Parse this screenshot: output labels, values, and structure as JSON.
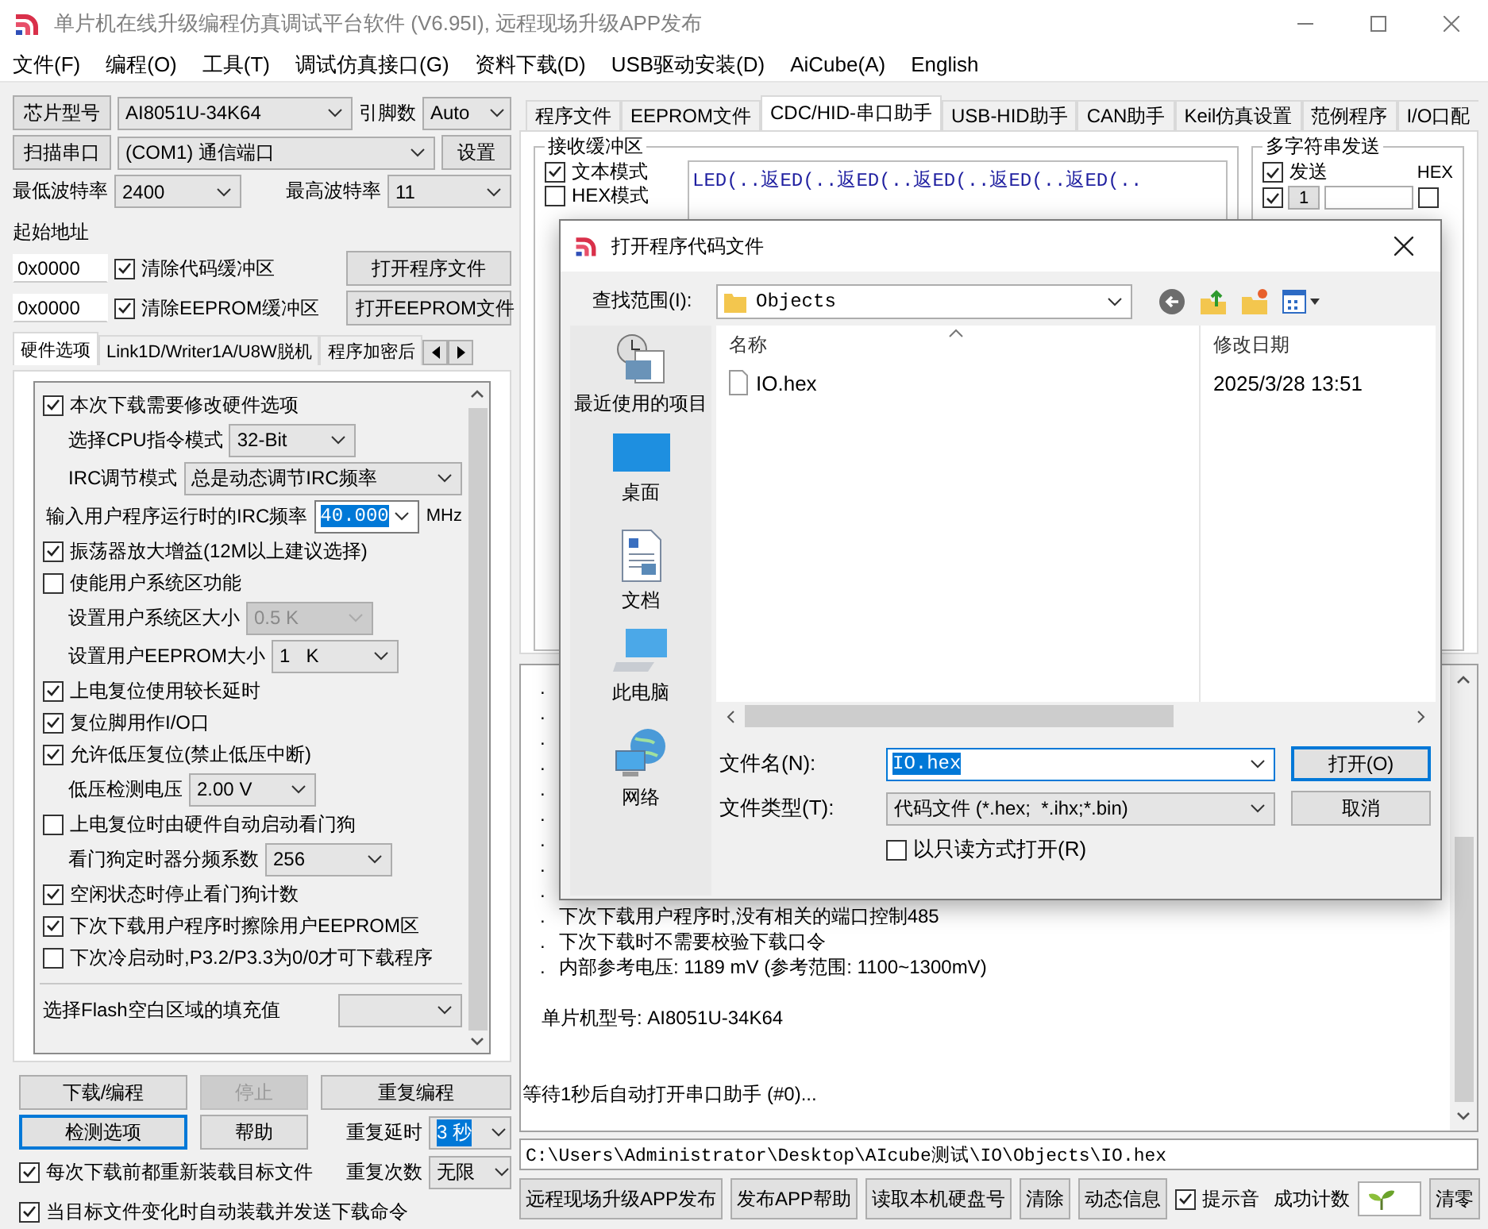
{
  "window": {
    "title": "单片机在线升级编程仿真调试平台软件 (V6.95I), 远程现场升级APP发布"
  },
  "menu": [
    "文件(F)",
    "编程(O)",
    "工具(T)",
    "调试仿真接口(G)",
    "资料下载(D)",
    "USB驱动安装(D)",
    "AiCube(A)",
    "English"
  ],
  "chip": {
    "button": "芯片型号",
    "value": "AI8051U-34K64",
    "pins_label": "引脚数",
    "pins": "Auto"
  },
  "port": {
    "button": "扫描串口",
    "value": "(COM1) 通信端口",
    "settings": "设置"
  },
  "baud": {
    "min_label": "最低波特率",
    "min": "2400",
    "max_label": "最高波特率",
    "max": "11"
  },
  "address": {
    "label": "起始地址",
    "rows": [
      {
        "value": "0x0000",
        "label": "清除代码缓冲区",
        "checked": true,
        "button": "打开程序文件"
      },
      {
        "value": "0x0000",
        "label": "清除EEPROM缓冲区",
        "checked": true,
        "button": "打开EEPROM文件"
      }
    ]
  },
  "left_tabs": [
    {
      "label": "硬件选项",
      "selected": true
    },
    {
      "label": "Link1D/Writer1A/U8W脱机",
      "selected": false
    },
    {
      "label": "程序加密后",
      "selected": false
    }
  ],
  "options": [
    {
      "kind": "check",
      "label": "本次下载需要修改硬件选项",
      "checked": true
    },
    {
      "kind": "select",
      "label": "选择CPU指令模式",
      "value": "32-Bit",
      "disabled": false
    },
    {
      "kind": "select",
      "label": "IRC调节模式",
      "value": "总是动态调节IRC频率",
      "disabled": false
    },
    {
      "kind": "combo",
      "label": "输入用户程序运行时的IRC频率",
      "value": "40.000",
      "highlighted": true,
      "unit": "MHz"
    },
    {
      "kind": "check",
      "label": "振荡器放大增益(12M以上建议选择)",
      "checked": true
    },
    {
      "kind": "check",
      "label": "使能用户系统区功能",
      "checked": false
    },
    {
      "kind": "select",
      "label": "设置用户系统区大小",
      "value": "0.5 K",
      "disabled": true
    },
    {
      "kind": "select",
      "label": "设置用户EEPROM大小",
      "value": "1   K",
      "disabled": false
    },
    {
      "kind": "check",
      "label": "上电复位使用较长延时",
      "checked": true
    },
    {
      "kind": "check",
      "label": "复位脚用作I/O口",
      "checked": true
    },
    {
      "kind": "check",
      "label": "允许低压复位(禁止低压中断)",
      "checked": true
    },
    {
      "kind": "select",
      "label": "低压检测电压",
      "value": "2.00 V",
      "disabled": false
    },
    {
      "kind": "check",
      "label": "上电复位时由硬件自动启动看门狗",
      "checked": false
    },
    {
      "kind": "select",
      "label": "看门狗定时器分频系数",
      "value": "256",
      "disabled": false
    },
    {
      "kind": "check",
      "label": "空闲状态时停止看门狗计数",
      "checked": true
    },
    {
      "kind": "check",
      "label": "下次下载用户程序时擦除用户EEPROM区",
      "checked": true
    },
    {
      "kind": "check",
      "label": "下次冷启动时,P3.2/P3.3为0/0才可下载程序",
      "checked": false
    },
    {
      "kind": "fill",
      "label": "选择Flash空白区域的填充值"
    }
  ],
  "program_buttons": [
    {
      "label": "下载/编程",
      "disabled": false,
      "focused": false
    },
    {
      "label": "停止",
      "disabled": true,
      "focused": false
    },
    {
      "label": "重复编程",
      "disabled": false,
      "focused": false
    },
    {
      "label": "检测选项",
      "disabled": false,
      "focused": true
    },
    {
      "label": "帮助",
      "disabled": false,
      "focused": false
    }
  ],
  "repeat": [
    {
      "label": "重复延时",
      "value": "3 秒",
      "highlighted": true
    },
    {
      "label": "重复次数",
      "value": "无限",
      "highlighted": false
    }
  ],
  "reload_options": [
    {
      "label": "每次下载前都重新装载目标文件",
      "checked": true
    },
    {
      "label": "当目标文件变化时自动装载并发送下载命令",
      "checked": true
    }
  ],
  "right_tabs": [
    {
      "label": "程序文件",
      "selected": false
    },
    {
      "label": "EEPROM文件",
      "selected": false
    },
    {
      "label": "CDC/HID-串口助手",
      "selected": true
    },
    {
      "label": "USB-HID助手",
      "selected": false
    },
    {
      "label": "CAN助手",
      "selected": false
    },
    {
      "label": "Keil仿真设置",
      "selected": false
    },
    {
      "label": "范例程序",
      "selected": false
    },
    {
      "label": "I/O口配",
      "selected": false
    }
  ],
  "receive": {
    "title": "接收缓冲区",
    "modes": [
      {
        "label": "文本模式",
        "checked": true
      },
      {
        "label": "HEX模式",
        "checked": false
      }
    ],
    "text": "LED(..返ED(..返ED(..返ED(..返ED(..返ED(.."
  },
  "multi_send": {
    "title": "多字符串发送",
    "send": {
      "label": "发送",
      "checked": true
    },
    "hex_header": "HEX",
    "rows": [
      {
        "checked": true,
        "index": "1",
        "hex": false
      }
    ]
  },
  "log": [
    {
      "kind": "bullet",
      "bullet": "."
    },
    {
      "kind": "bullet",
      "bullet": "."
    },
    {
      "kind": "bullet",
      "bullet": "."
    },
    {
      "kind": "bullet",
      "bullet": "."
    },
    {
      "kind": "bullet",
      "bullet": "."
    },
    {
      "kind": "bullet",
      "bullet": "."
    },
    {
      "kind": "bullet",
      "bullet": "."
    },
    {
      "kind": "bullet",
      "bullet": "."
    },
    {
      "kind": "bullet",
      "bullet": "."
    },
    {
      "kind": "bullet",
      "bullet": ".",
      "text": "下次下载用户程序时,没有相关的端口控制485"
    },
    {
      "kind": "bullet",
      "bullet": ".",
      "text": "下次下载时不需要校验下载口令"
    },
    {
      "kind": "bullet",
      "bullet": ".",
      "text": "内部参考电压: 1189 mV (参考范围: 1100~1300mV)"
    },
    {
      "kind": "blank"
    },
    {
      "kind": "indented",
      "text": "单片机型号: AI8051U-34K64"
    },
    {
      "kind": "blank"
    },
    {
      "kind": "blank"
    },
    {
      "kind": "plain",
      "text": "等待1秒后自动打开串口助手 (#0)..."
    }
  ],
  "path": "C:\\Users\\Administrator\\Desktop\\AIcube测试\\IO\\Objects\\IO.hex",
  "bottom": {
    "buttons": [
      "远程现场升级APP发布",
      "发布APP帮助",
      "读取本机硬盘号",
      "清除",
      "动态信息"
    ],
    "sound": {
      "label": "提示音",
      "checked": true
    },
    "count_label": "成功计数",
    "reset": "清零"
  },
  "dialog": {
    "title": "打开程序代码文件",
    "look_in_label": "查找范围(I):",
    "look_in": "Objects",
    "places": [
      "最近使用的项目",
      "桌面",
      "文档",
      "此电脑",
      "网络"
    ],
    "columns": [
      "名称",
      "修改日期"
    ],
    "files": [
      {
        "name": "IO.hex",
        "modified": "2025/3/28 13:51"
      }
    ],
    "filename_label": "文件名(N):",
    "filename": "IO.hex",
    "filename_selected": true,
    "type_label": "文件类型(T):",
    "type": "代码文件 (*.hex;  *.ihx;*.bin)",
    "readonly": {
      "label": "以只读方式打开(R)",
      "checked": false
    },
    "buttons": [
      {
        "label": "打开(O)",
        "default": true
      },
      {
        "label": "取消",
        "default": false
      }
    ]
  }
}
